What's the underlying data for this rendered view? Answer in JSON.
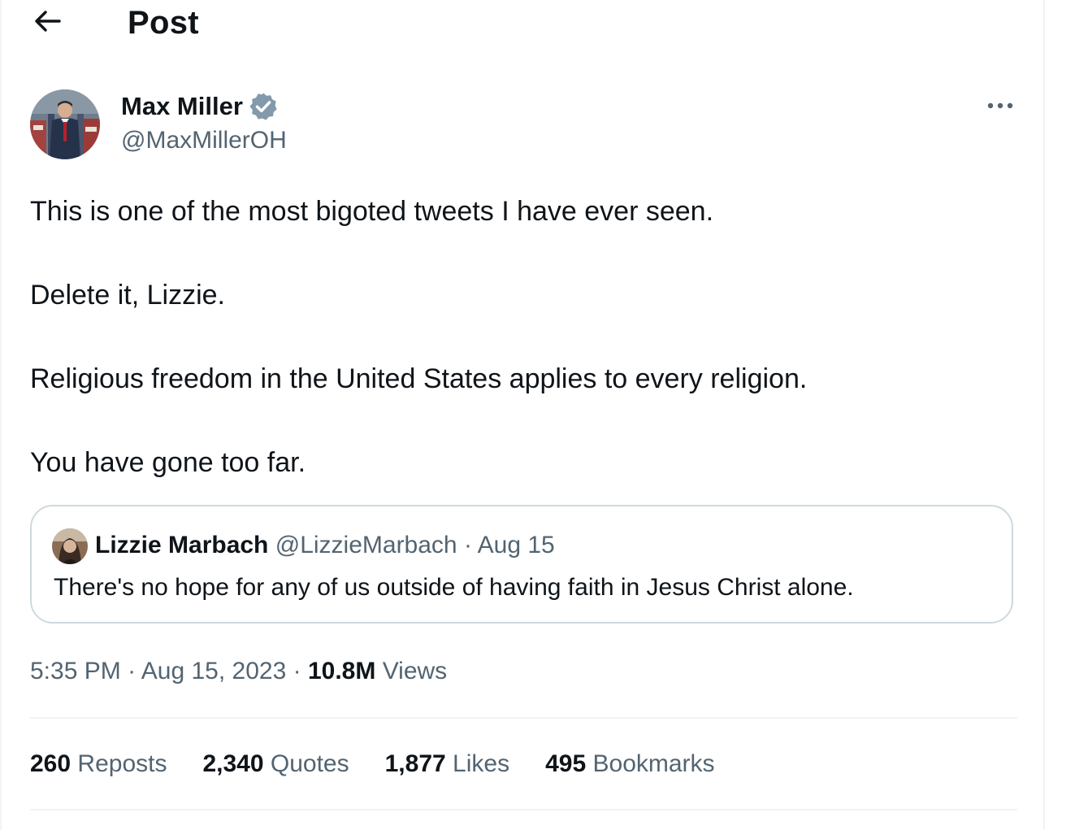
{
  "header": {
    "title": "Post",
    "back_icon": "arrow-left-icon"
  },
  "author": {
    "name": "Max Miller",
    "handle": "@MaxMillerOH",
    "verified_icon": "verified-badge-icon",
    "verified_color": "#829aab",
    "more_icon": "more-horizontal-icon"
  },
  "tweet": {
    "paragraphs": [
      "This is one of the most bigoted tweets I have ever seen.",
      "Delete it, Lizzie.",
      "Religious freedom in the United States applies to every religion.",
      "You have gone too far."
    ]
  },
  "quote": {
    "name": "Lizzie Marbach",
    "handle": "@LizzieMarbach",
    "separator": "·",
    "date": "Aug 15",
    "text": "There's no hope for any of us outside of having faith in Jesus Christ alone."
  },
  "meta": {
    "time": "5:35 PM",
    "separator": "·",
    "date": "Aug 15, 2023",
    "views_count": "10.8M",
    "views_label": "Views"
  },
  "stats": [
    {
      "count": "260",
      "label": "Reposts"
    },
    {
      "count": "2,340",
      "label": "Quotes"
    },
    {
      "count": "1,877",
      "label": "Likes"
    },
    {
      "count": "495",
      "label": "Bookmarks"
    }
  ],
  "colors": {
    "text_primary": "#0f1419",
    "text_secondary": "#536471",
    "border": "#cfd9de",
    "divider": "#eff3f4"
  }
}
